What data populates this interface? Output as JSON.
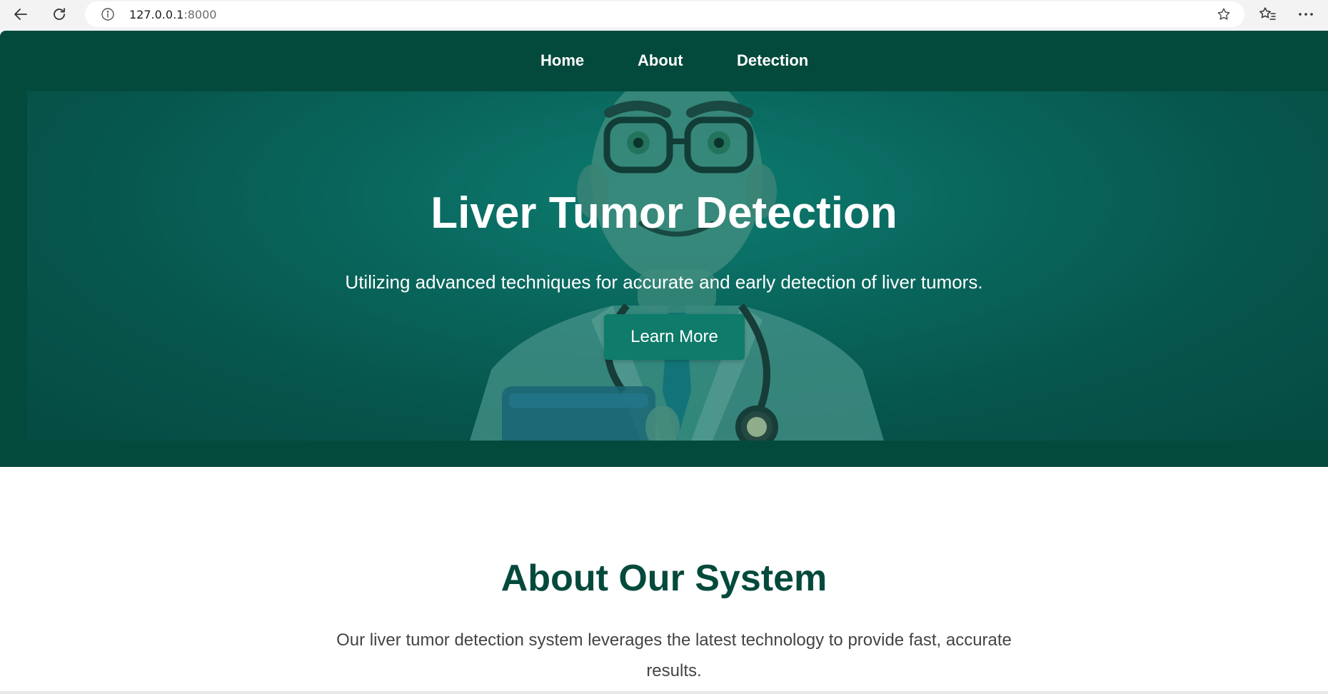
{
  "browser": {
    "url_host": "127.0.0.1",
    "url_port": ":8000",
    "icons": [
      "back-arrow-icon",
      "reload-icon",
      "info-icon",
      "star-icon",
      "favorites-icon",
      "more-icon"
    ]
  },
  "nav": {
    "items": [
      {
        "label": "Home"
      },
      {
        "label": "About"
      },
      {
        "label": "Detection"
      }
    ]
  },
  "hero": {
    "title": "Liver Tumor Detection",
    "subtitle": "Utilizing advanced techniques for accurate and early detection of liver tumors.",
    "cta_label": "Learn More"
  },
  "about": {
    "title": "About Our System",
    "text": "Our liver tumor detection system leverages the latest technology to provide fast, accurate results."
  },
  "colors": {
    "brand_dark_green": "#044a3c",
    "button_teal": "#0f7b6a",
    "text_gray": "#444444",
    "white": "#ffffff"
  }
}
